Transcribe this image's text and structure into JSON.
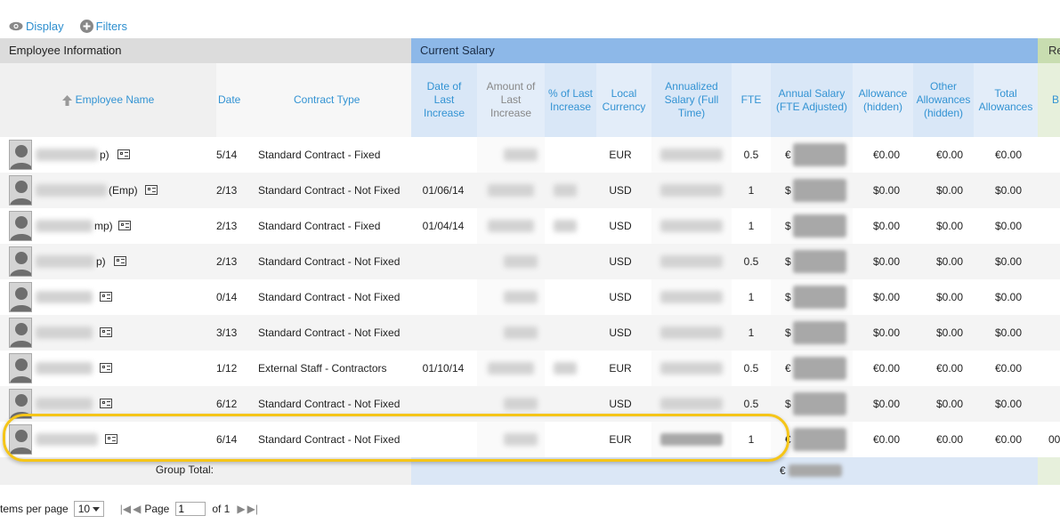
{
  "toolbar": {
    "display_label": "Display",
    "filters_label": "Filters"
  },
  "groups": {
    "employee": "Employee Information",
    "salary": "Current Salary",
    "re": "Re"
  },
  "columns": {
    "employee_name": "Employee Name",
    "date": "Date",
    "contract_type": "Contract Type",
    "date_last_increase": "Date of Last Increase",
    "amount_last_increase": "Amount of Last Increase",
    "pct_last_increase": "% of Last Increase",
    "local_currency": "Local Currency",
    "annualized_salary": "Annualized Salary (Full Time)",
    "fte": "FTE",
    "annual_salary_fte": "Annual Salary (FTE Adjusted)",
    "allowance_hidden": "Allowance (hidden)",
    "other_allowances": "Other Allowances (hidden)",
    "total_allowances": "Total Allowances",
    "re_col": "B"
  },
  "rows": [
    {
      "name_suffix": "p)",
      "date": "5/14",
      "contract": "Standard Contract - Fixed",
      "dli": "",
      "currency": "EUR",
      "fte": "0.5",
      "sym": "€",
      "allow": "€0.00",
      "other": "€0.00",
      "total": "€0.00"
    },
    {
      "name_suffix": "(Emp)",
      "date": "2/13",
      "contract": "Standard Contract - Not Fixed",
      "dli": "01/06/14",
      "currency": "USD",
      "fte": "1",
      "sym": "$",
      "allow": "$0.00",
      "other": "$0.00",
      "total": "$0.00"
    },
    {
      "name_suffix": "mp)",
      "date": "2/13",
      "contract": "Standard Contract - Fixed",
      "dli": "01/04/14",
      "currency": "USD",
      "fte": "1",
      "sym": "$",
      "allow": "$0.00",
      "other": "$0.00",
      "total": "$0.00"
    },
    {
      "name_suffix": "p)",
      "date": "2/13",
      "contract": "Standard Contract - Not Fixed",
      "dli": "",
      "currency": "USD",
      "fte": "0.5",
      "sym": "$",
      "allow": "$0.00",
      "other": "$0.00",
      "total": "$0.00"
    },
    {
      "name_suffix": "",
      "date": "0/14",
      "contract": "Standard Contract - Not Fixed",
      "dli": "",
      "currency": "USD",
      "fte": "1",
      "sym": "$",
      "allow": "$0.00",
      "other": "$0.00",
      "total": "$0.00"
    },
    {
      "name_suffix": "",
      "date": "3/13",
      "contract": "Standard Contract - Not Fixed",
      "dli": "",
      "currency": "USD",
      "fte": "1",
      "sym": "$",
      "allow": "$0.00",
      "other": "$0.00",
      "total": "$0.00"
    },
    {
      "name_suffix": "",
      "date": "1/12",
      "contract": "External Staff - Contractors",
      "dli": "01/10/14",
      "currency": "EUR",
      "fte": "0.5",
      "sym": "€",
      "allow": "€0.00",
      "other": "€0.00",
      "total": "€0.00"
    },
    {
      "name_suffix": "",
      "date": "6/12",
      "contract": "Standard Contract - Not Fixed",
      "dli": "",
      "currency": "USD",
      "fte": "0.5",
      "sym": "$",
      "allow": "$0.00",
      "other": "$0.00",
      "total": "$0.00"
    },
    {
      "name_suffix": "",
      "date": "6/14",
      "contract": "Standard Contract - Not Fixed",
      "dli": "",
      "currency": "EUR",
      "fte": "1",
      "sym": "€",
      "allow": "€0.00",
      "other": "€0.00",
      "total": "€0.00",
      "re": "00"
    }
  ],
  "total": {
    "label": "Group Total:",
    "sym": "€"
  },
  "pager": {
    "items_label": "tems per page",
    "per_page": "10",
    "page_label": "Page",
    "page_value": "1",
    "of_label": "of 1"
  }
}
